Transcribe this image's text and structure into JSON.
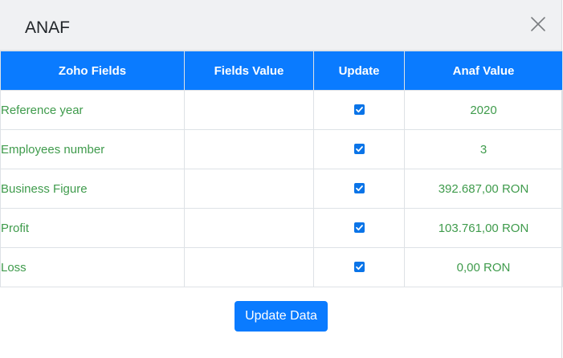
{
  "modal": {
    "title": "ANAF",
    "close_icon": "close-icon"
  },
  "table": {
    "headers": [
      "Zoho Fields",
      "Fields Value",
      "Update",
      "Anaf Value"
    ],
    "rows": [
      {
        "field": "Reference year",
        "fields_value": "",
        "update_checked": true,
        "anaf_value": "2020"
      },
      {
        "field": "Employees number",
        "fields_value": "",
        "update_checked": true,
        "anaf_value": "3"
      },
      {
        "field": "Business Figure",
        "fields_value": "",
        "update_checked": true,
        "anaf_value": "392.687,00 RON"
      },
      {
        "field": "Profit",
        "fields_value": "",
        "update_checked": true,
        "anaf_value": "103.761,00 RON"
      },
      {
        "field": "Loss",
        "fields_value": "",
        "update_checked": true,
        "anaf_value": "0,00 RON"
      }
    ]
  },
  "footer": {
    "update_button_label": "Update Data"
  },
  "colors": {
    "header_bg": "#0a7bff",
    "row_text": "#3f9b4c",
    "checkbox": "#0a74e8"
  }
}
